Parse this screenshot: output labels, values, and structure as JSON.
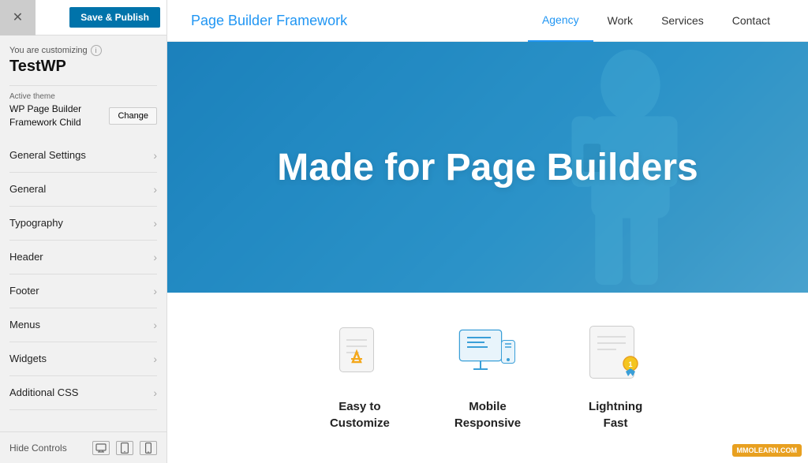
{
  "panel": {
    "header": {
      "save_label": "Save & Publish",
      "close_icon": "×"
    },
    "customizing_label": "You are customizing",
    "info_icon": "i",
    "site_name": "TestWP",
    "theme": {
      "label": "Active theme",
      "name": "WP Page Builder\nFramework Child",
      "change_button": "Change"
    },
    "menu_items": [
      {
        "label": "General Settings"
      },
      {
        "label": "General"
      },
      {
        "label": "Typography"
      },
      {
        "label": "Header"
      },
      {
        "label": "Footer"
      },
      {
        "label": "Menus"
      },
      {
        "label": "Widgets"
      },
      {
        "label": "Additional CSS"
      }
    ],
    "hide_controls": "Hide Controls",
    "device_icons": [
      "desktop",
      "tablet",
      "mobile"
    ]
  },
  "preview": {
    "brand": "Page Builder Framework",
    "nav_links": [
      {
        "label": "Agency",
        "active": true
      },
      {
        "label": "Work",
        "active": false
      },
      {
        "label": "Services",
        "active": false
      },
      {
        "label": "Contact",
        "active": false
      }
    ],
    "hero": {
      "text": "Made for Page Builders"
    },
    "features": [
      {
        "label": "Easy to\nCustomize",
        "icon": "doc"
      },
      {
        "label": "Mobile\nResponsive",
        "icon": "monitor"
      },
      {
        "label": "Lightning\nFast",
        "icon": "cert"
      }
    ],
    "watermark": "MMOLEARN.COM"
  }
}
